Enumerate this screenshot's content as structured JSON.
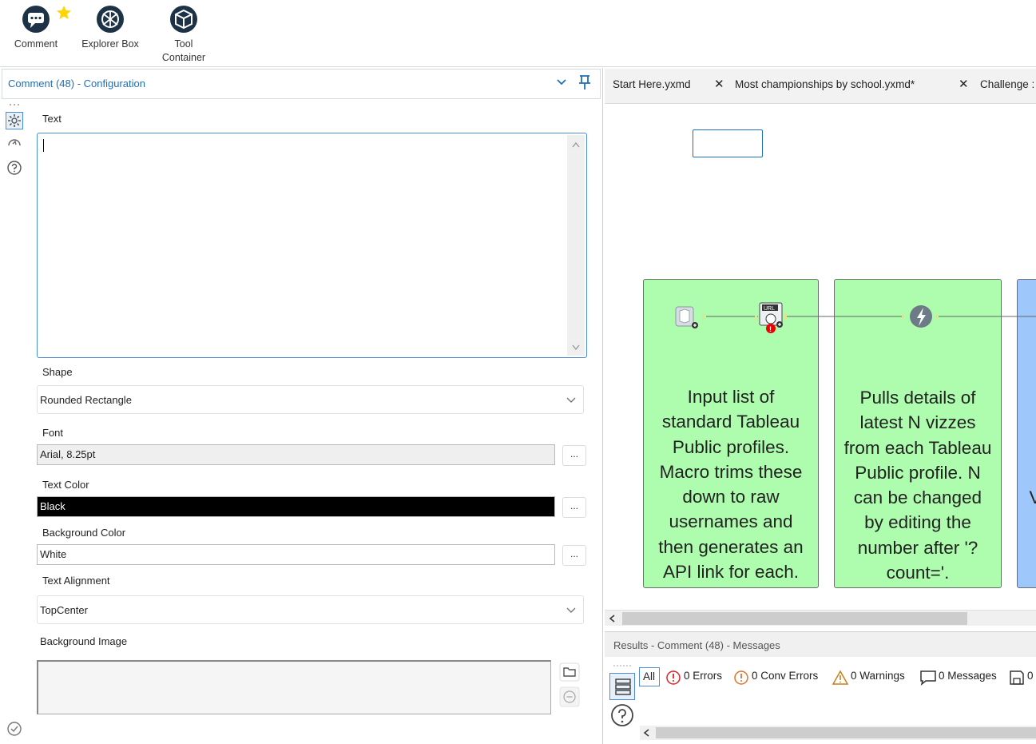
{
  "ribbon": {
    "tools": [
      {
        "label": "Comment"
      },
      {
        "label": "Explorer Box"
      },
      {
        "label": "Tool",
        "label2": "Container"
      }
    ]
  },
  "config": {
    "title": "Comment (48) - Configuration",
    "text_label": "Text",
    "text_value": "",
    "shape_label": "Shape",
    "shape_value": "Rounded Rectangle",
    "font_label": "Font",
    "font_value": "Arial, 8.25pt",
    "text_color_label": "Text Color",
    "text_color_value": "Black",
    "bg_color_label": "Background Color",
    "bg_color_value": "White",
    "alignment_label": "Text Alignment",
    "alignment_value": "TopCenter",
    "bg_image_label": "Background Image",
    "dots": "..."
  },
  "tabs": [
    {
      "label": "Start Here.yxmd"
    },
    {
      "label": "Most championships by school.yxmd*"
    },
    {
      "label": "Challenge :"
    }
  ],
  "canvas": {
    "note1": [
      "Input list of",
      "standard Tableau",
      "Public profiles.",
      "Macro trims these",
      "down to raw",
      "usernames and",
      "then generates an",
      "API link for each."
    ],
    "note2": [
      "Pulls details of",
      "latest N vizzes",
      "from each Tableau",
      "Public profile. N",
      "can be changed",
      "by editing the",
      "number after '?",
      "count='."
    ],
    "note3_partial": "V",
    "colors": {
      "green": "#aefdae",
      "blue": "#9ec8fb"
    }
  },
  "results": {
    "title": "Results - Comment (48) - Messages",
    "all": "All",
    "errors": "0 Errors",
    "conv_errors": "0 Conv Errors",
    "warnings": "0 Warnings",
    "messages": "0 Messages",
    "files": "0"
  }
}
